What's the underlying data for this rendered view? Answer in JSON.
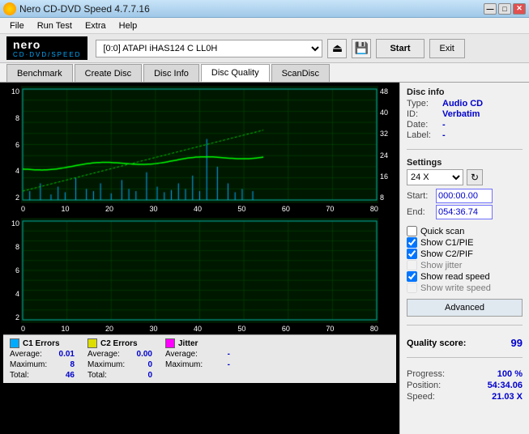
{
  "titlebar": {
    "title": "Nero CD-DVD Speed 4.7.7.16",
    "min": "—",
    "max": "□",
    "close": "✕"
  },
  "menu": {
    "items": [
      "File",
      "Run Test",
      "Extra",
      "Help"
    ]
  },
  "toolbar": {
    "logo_nero": "nero",
    "logo_sub": "CD·DVD/SPEED",
    "drive": "[0:0]  ATAPI iHAS124  C LL0H",
    "start": "Start",
    "exit": "Exit"
  },
  "tabs": {
    "items": [
      "Benchmark",
      "Create Disc",
      "Disc Info",
      "Disc Quality",
      "ScanDisc"
    ],
    "active": "Disc Quality"
  },
  "charts": {
    "top": {
      "left_axis": [
        "10",
        "8",
        "6",
        "4",
        "2"
      ],
      "right_axis": [
        "48",
        "40",
        "32",
        "24",
        "16",
        "8"
      ],
      "x_labels": [
        "0",
        "10",
        "20",
        "30",
        "40",
        "50",
        "60",
        "70",
        "80"
      ]
    },
    "bottom": {
      "left_axis": [
        "10",
        "8",
        "6",
        "4",
        "2"
      ],
      "x_labels": [
        "0",
        "10",
        "20",
        "30",
        "40",
        "50",
        "60",
        "70",
        "80"
      ]
    }
  },
  "legend": {
    "c1": {
      "title": "C1 Errors",
      "color": "#00aaff",
      "rows": [
        {
          "label": "Average:",
          "value": "0.01"
        },
        {
          "label": "Maximum:",
          "value": "8"
        },
        {
          "label": "Total:",
          "value": "46"
        }
      ]
    },
    "c2": {
      "title": "C2 Errors",
      "color": "#ffff00",
      "rows": [
        {
          "label": "Average:",
          "value": "0.00"
        },
        {
          "label": "Maximum:",
          "value": "0"
        },
        {
          "label": "Total:",
          "value": "0"
        }
      ]
    },
    "jitter": {
      "title": "Jitter",
      "color": "#ff00ff",
      "rows": [
        {
          "label": "Average:",
          "value": "-"
        },
        {
          "label": "Maximum:",
          "value": "-"
        }
      ]
    }
  },
  "sidebar": {
    "disc_info_label": "Disc info",
    "type_label": "Type:",
    "type_value": "Audio CD",
    "id_label": "ID:",
    "id_value": "Verbatim",
    "date_label": "Date:",
    "date_value": "-",
    "label_label": "Label:",
    "label_value": "-",
    "settings_label": "Settings",
    "speed_value": "24 X",
    "start_label": "Start:",
    "start_value": "000:00.00",
    "end_label": "End:",
    "end_value": "054:36.74",
    "checkboxes": [
      {
        "label": "Quick scan",
        "checked": false,
        "enabled": true
      },
      {
        "label": "Show C1/PIE",
        "checked": true,
        "enabled": true
      },
      {
        "label": "Show C2/PIF",
        "checked": true,
        "enabled": true
      },
      {
        "label": "Show jitter",
        "checked": false,
        "enabled": false
      },
      {
        "label": "Show read speed",
        "checked": true,
        "enabled": true
      },
      {
        "label": "Show write speed",
        "checked": false,
        "enabled": false
      }
    ],
    "advanced_btn": "Advanced",
    "quality_score_label": "Quality score:",
    "quality_score_value": "99",
    "progress_label": "Progress:",
    "progress_value": "100 %",
    "position_label": "Position:",
    "position_value": "54:34.06",
    "speed_label": "Speed:",
    "speed_value2": "21.03 X"
  }
}
